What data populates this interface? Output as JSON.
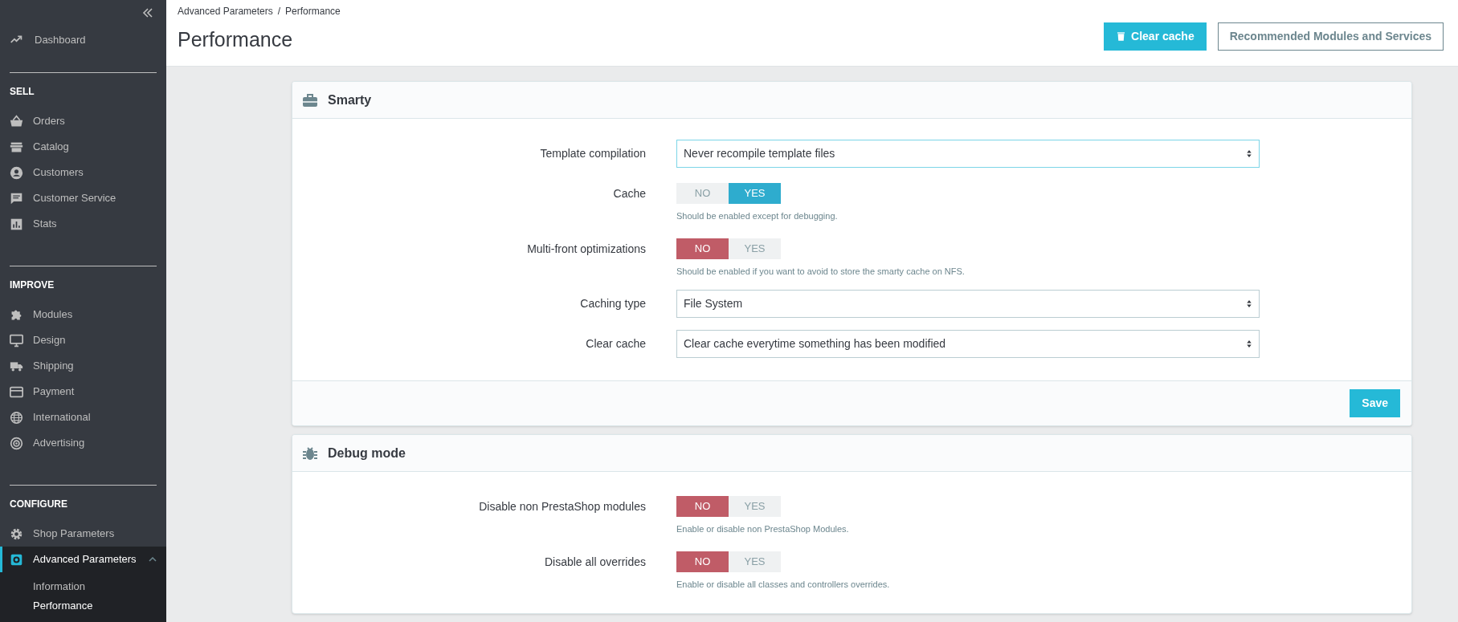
{
  "sidebar": {
    "dashboard": {
      "label": "Dashboard"
    },
    "sections": [
      {
        "title": "SELL",
        "items": [
          {
            "label": "Orders",
            "selected": false
          },
          {
            "label": "Catalog",
            "selected": false
          },
          {
            "label": "Customers",
            "selected": false
          },
          {
            "label": "Customer Service",
            "selected": false
          },
          {
            "label": "Stats",
            "selected": false
          }
        ]
      },
      {
        "title": "IMPROVE",
        "items": [
          {
            "label": "Modules",
            "selected": false
          },
          {
            "label": "Design",
            "selected": false
          },
          {
            "label": "Shipping",
            "selected": false
          },
          {
            "label": "Payment",
            "selected": false
          },
          {
            "label": "International",
            "selected": false
          },
          {
            "label": "Advertising",
            "selected": false
          }
        ]
      },
      {
        "title": "CONFIGURE",
        "items": [
          {
            "label": "Shop Parameters",
            "selected": false
          },
          {
            "label": "Advanced Parameters",
            "selected": true,
            "expanded": true,
            "children": [
              {
                "label": "Information",
                "selected": false
              },
              {
                "label": "Performance",
                "selected": true
              }
            ]
          }
        ]
      }
    ]
  },
  "header": {
    "breadcrumb": [
      "Advanced Parameters",
      "Performance"
    ],
    "separator": "/",
    "title": "Performance",
    "buttons": [
      {
        "label": "Clear cache",
        "kind": "primary"
      },
      {
        "label": "Recommended Modules and Services",
        "kind": "outline"
      }
    ]
  },
  "panels": [
    {
      "title": "Smarty",
      "save": "Save",
      "rows": [
        {
          "kind": "select",
          "label": "Template compilation",
          "value": "Never recompile template files",
          "focused": true
        },
        {
          "kind": "toggle",
          "label": "Cache",
          "options": [
            {
              "label": "NO",
              "selected": false
            },
            {
              "label": "YES",
              "selected": true
            }
          ],
          "help": "Should be enabled except for debugging."
        },
        {
          "kind": "toggle",
          "label": "Multi-front optimizations",
          "options": [
            {
              "label": "NO",
              "selected": true
            },
            {
              "label": "YES",
              "selected": false
            }
          ],
          "help": "Should be enabled if you want to avoid to store the smarty cache on NFS."
        },
        {
          "kind": "select",
          "label": "Caching type",
          "value": "File System",
          "focused": false
        },
        {
          "kind": "select",
          "label": "Clear cache",
          "value": "Clear cache everytime something has been modified",
          "focused": false
        }
      ]
    },
    {
      "title": "Debug mode",
      "rows": [
        {
          "kind": "toggle",
          "label": "Disable non PrestaShop modules",
          "options": [
            {
              "label": "NO",
              "selected": true
            },
            {
              "label": "YES",
              "selected": false
            }
          ],
          "help": "Enable or disable non PrestaShop Modules."
        },
        {
          "kind": "toggle",
          "label": "Disable all overrides",
          "options": [
            {
              "label": "NO",
              "selected": true
            },
            {
              "label": "YES",
              "selected": false
            }
          ],
          "help": "Enable or disable all classes and controllers overrides."
        }
      ]
    }
  ]
}
